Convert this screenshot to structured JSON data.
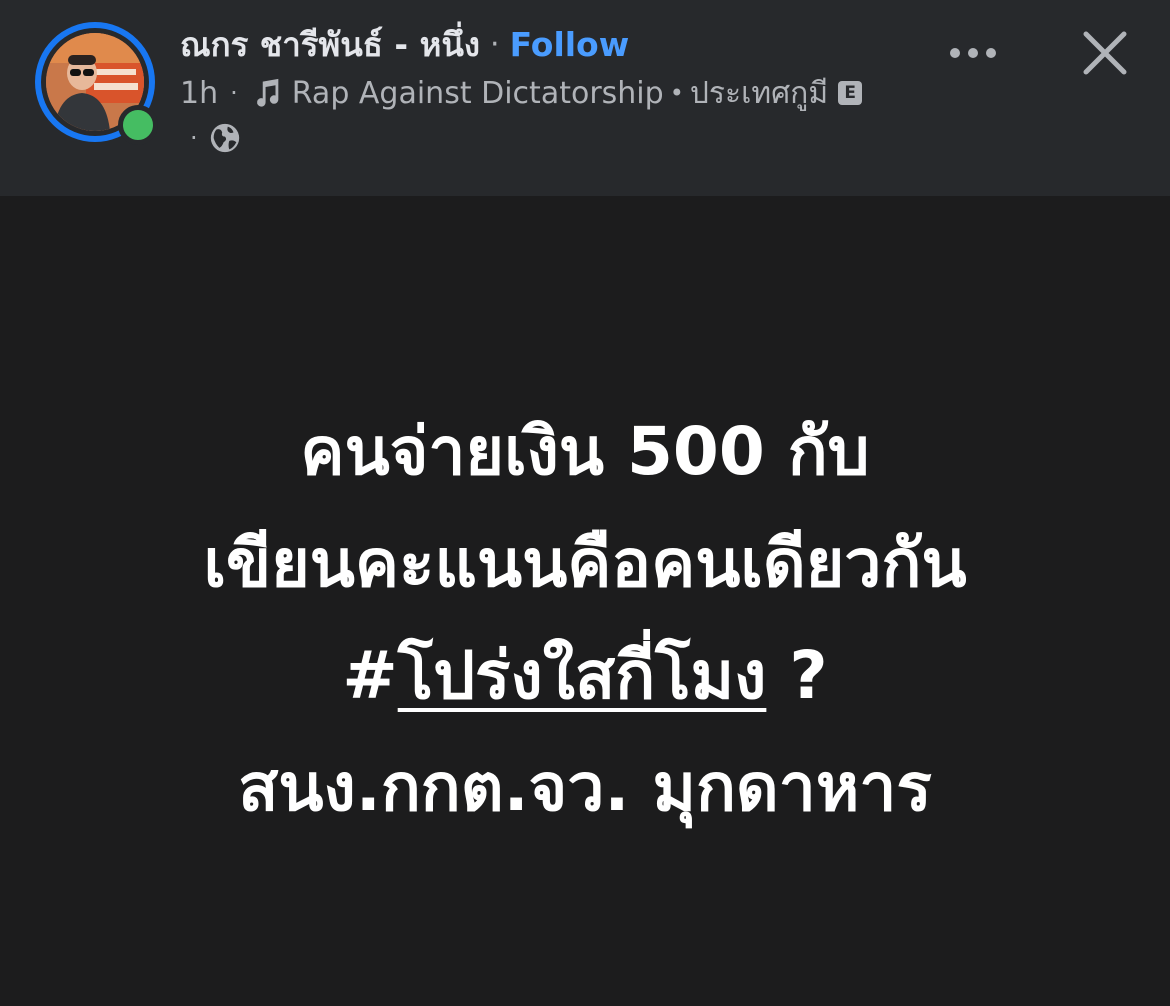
{
  "header": {
    "author_name": "ณกร ชารีพันธ์ - หนึ่ง",
    "separator": "·",
    "follow_label": "Follow",
    "time": "1h",
    "meta_separator": "·",
    "music_title": "Rap Against Dictatorship",
    "music_separator": "•",
    "song_name": "ประเทศกูมี",
    "explicit_badge": "E",
    "privacy_separator": "·",
    "icons": {
      "music": "music-note-icon",
      "explicit": "explicit-badge-icon",
      "privacy": "globe-icon",
      "more": "more-options-icon",
      "close": "close-icon"
    }
  },
  "post": {
    "line1": "คนจ่ายเงิน 500 กับ",
    "line2": "เขียนคะแนนคือคนเดียวกัน",
    "hashtag": "#",
    "hashtag_link": "โปร่งใสกี่โมง",
    "line3_suffix": " ?",
    "line4": "สนง.กกต.จว. มุกดาหาร"
  },
  "colors": {
    "header_bg": "#27292c",
    "content_bg": "#1c1c1d",
    "accent_blue": "#4a9cff",
    "avatar_ring": "#1877f2",
    "online_green": "#45bd62",
    "secondary_text": "#b0b3b8",
    "primary_text": "#e4e6eb"
  }
}
